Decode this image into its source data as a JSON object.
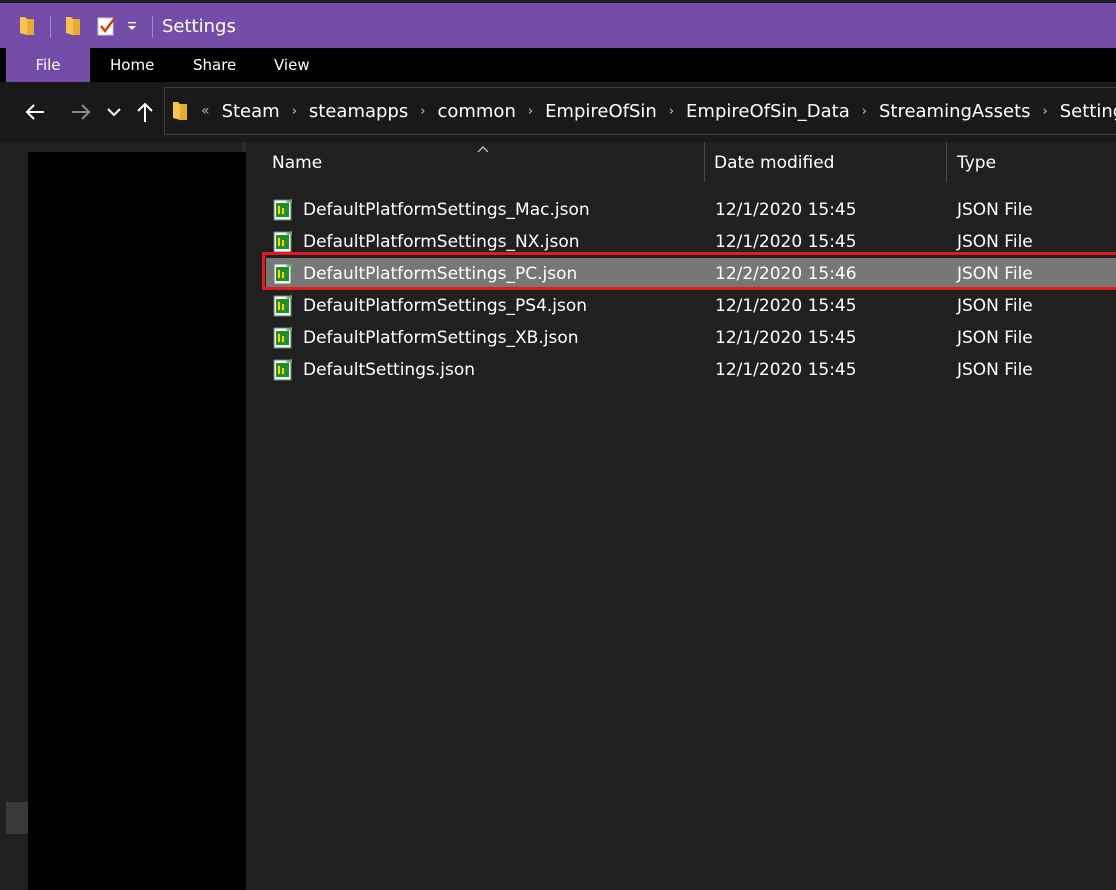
{
  "window": {
    "title": "Settings"
  },
  "ribbon": {
    "tabs": [
      "File",
      "Home",
      "Share",
      "View"
    ]
  },
  "breadcrumb": {
    "overflow": "«",
    "items": [
      "Steam",
      "steamapps",
      "common",
      "EmpireOfSin",
      "EmpireOfSin_Data",
      "StreamingAssets",
      "Settings"
    ],
    "separator": "›"
  },
  "columns": {
    "name": "Name",
    "date": "Date modified",
    "type": "Type"
  },
  "files": [
    {
      "name": "DefaultPlatformSettings_Mac.json",
      "date": "12/1/2020 15:45",
      "type": "JSON File",
      "selected": false
    },
    {
      "name": "DefaultPlatformSettings_NX.json",
      "date": "12/1/2020 15:45",
      "type": "JSON File",
      "selected": false
    },
    {
      "name": "DefaultPlatformSettings_PC.json",
      "date": "12/2/2020 15:46",
      "type": "JSON File",
      "selected": true
    },
    {
      "name": "DefaultPlatformSettings_PS4.json",
      "date": "12/1/2020 15:45",
      "type": "JSON File",
      "selected": false
    },
    {
      "name": "DefaultPlatformSettings_XB.json",
      "date": "12/1/2020 15:45",
      "type": "JSON File",
      "selected": false
    },
    {
      "name": "DefaultSettings.json",
      "date": "12/1/2020 15:45",
      "type": "JSON File",
      "selected": false
    }
  ],
  "colors": {
    "accent": "#744da9",
    "selection": "#777777",
    "highlight_box": "#e41b1b"
  },
  "icons": {
    "title": [
      "folder-icon",
      "folder-icon",
      "checklist-icon",
      "dropdown-icon"
    ],
    "nav": [
      "back-arrow-icon",
      "forward-arrow-icon",
      "chevron-down-icon",
      "up-arrow-icon"
    ],
    "file": "json-file-icon"
  }
}
